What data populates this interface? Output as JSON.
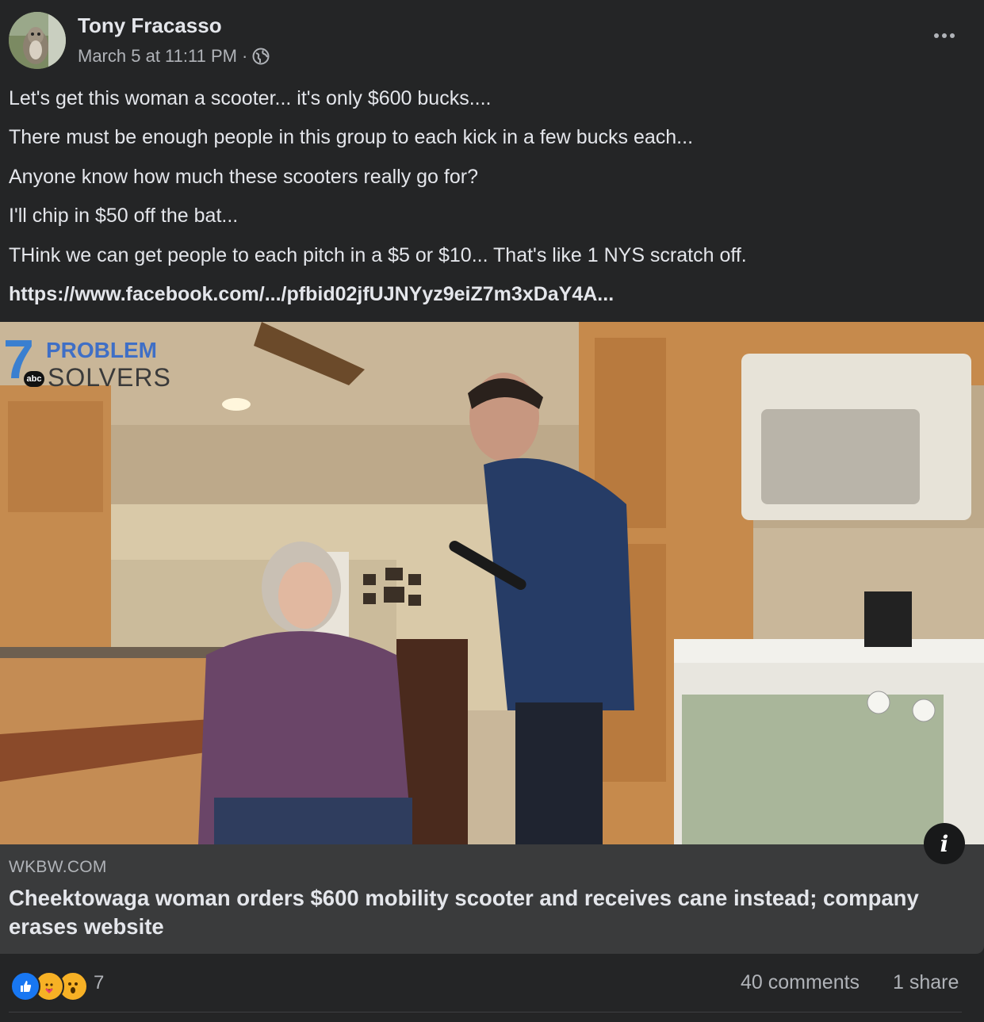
{
  "post": {
    "author": "Tony Fracasso",
    "timestamp": "March 5 at 11:11 PM",
    "separator": "·",
    "privacy_icon": "globe-icon",
    "more_icon": "more-options-icon",
    "lines": [
      "Let's get this woman a scooter... it's only $600 bucks....",
      "There must be enough people in this group to each kick in a few bucks each...",
      "Anyone know how much these scooters really go for?",
      "I'll chip in $50 off the bat...",
      "THink we can get people to each pitch in a $5 or $10... That's like 1 NYS scratch off."
    ],
    "link_text": "https://www.facebook.com/.../pfbid02jfUJNYyz9eiZ7m3xDaY4A..."
  },
  "media": {
    "logo_number": "7",
    "logo_word1": "PROBLEM",
    "logo_network": "abc",
    "logo_word2": "SOLVERS",
    "info_icon_text": "i"
  },
  "link_preview": {
    "domain": "WKBW.COM",
    "headline": "Cheektowaga woman orders $600 mobility scooter and receives cane instead; company erases website"
  },
  "footer": {
    "reaction_icons": [
      "like-icon",
      "care-icon",
      "wow-icon"
    ],
    "reaction_count": "7",
    "comments": "40 comments",
    "shares": "1 share"
  },
  "colors": {
    "background": "#242526",
    "link_preview_bg": "#3a3b3c",
    "primary_text": "#e4e6eb",
    "secondary_text": "#b0b3b8",
    "like_blue": "#1877f2",
    "reaction_yellow": "#f7b125"
  }
}
